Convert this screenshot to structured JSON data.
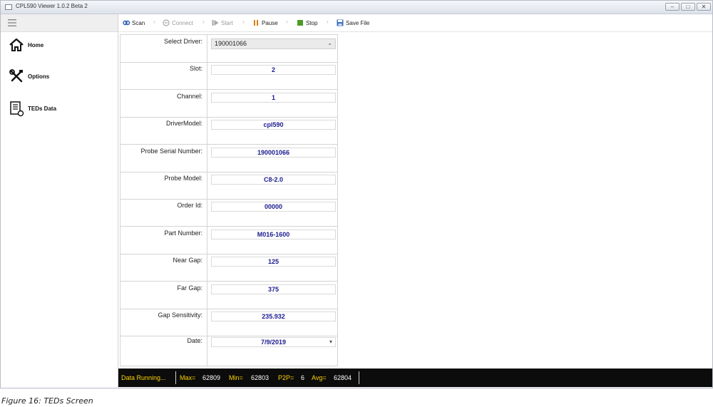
{
  "window": {
    "title": "CPL590 Viewer 1.0.2 Beta 2",
    "controls": {
      "minimize": "–",
      "maximize": "□",
      "close": "✕"
    }
  },
  "sidebar": {
    "items": [
      {
        "label": "Home",
        "icon": "home-icon"
      },
      {
        "label": "Options",
        "icon": "tools-icon"
      },
      {
        "label": "TEDs Data",
        "icon": "teds-data-icon"
      }
    ]
  },
  "toolbar": {
    "scan": "Scan",
    "connect": "Connect",
    "start": "Start",
    "pause": "Pause",
    "stop": "Stop",
    "save_file": "Save File",
    "separator": "›"
  },
  "form": {
    "select_driver": {
      "label": "Select Driver:",
      "value": "190001066"
    },
    "rows": [
      {
        "label": "Slot:",
        "value": "2"
      },
      {
        "label": "Channel:",
        "value": "1"
      },
      {
        "label": "DriverModel:",
        "value": "cpl590"
      },
      {
        "label": "Probe Serial Number:",
        "value": "190001066"
      },
      {
        "label": "Probe Model:",
        "value": "C8-2.0"
      },
      {
        "label": "Order Id:",
        "value": "00000"
      },
      {
        "label": "Part Number:",
        "value": "M016-1600"
      },
      {
        "label": "Near Gap:",
        "value": "125"
      },
      {
        "label": "Far Gap:",
        "value": "375"
      },
      {
        "label": "Gap Sensitivity:",
        "value": "235.932"
      }
    ],
    "date": {
      "label": "Date:",
      "value": "7/9/2019"
    }
  },
  "status": {
    "state": "Data Running...",
    "max_label": "Max=",
    "max_value": "62809",
    "min_label": "Min=",
    "min_value": "62803",
    "p2p_label": "P2P=",
    "p2p_value": "6",
    "avg_label": "Avg=",
    "avg_value": "62804"
  },
  "caption": "Figure 16: TEDs Screen",
  "colors": {
    "value_text": "#1b1b8f",
    "status_background": "#0c0c0c",
    "status_label": "#ffd400",
    "status_value": "#ffffff"
  }
}
